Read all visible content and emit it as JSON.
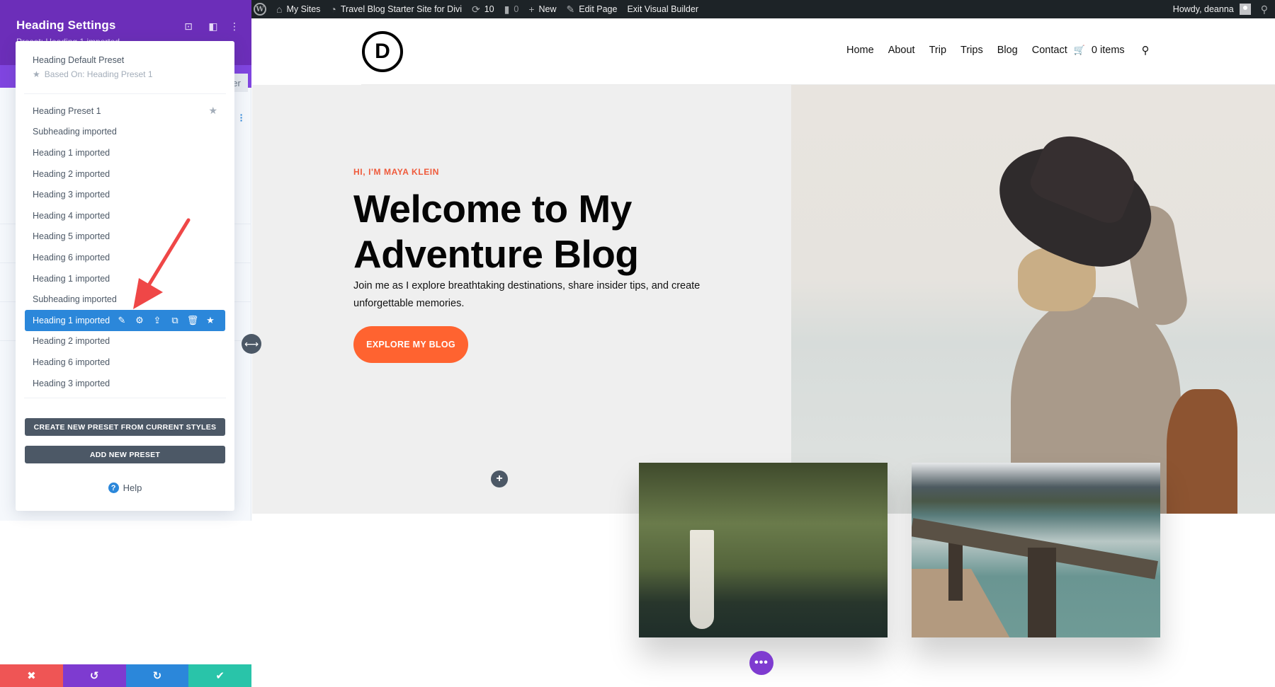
{
  "admin_bar": {
    "items": [
      {
        "icon": "wordpress-logo-icon",
        "label": ""
      },
      {
        "icon": "my-sites-icon",
        "label": "My Sites"
      },
      {
        "icon": "site-dashboard-icon",
        "label": "Travel Blog Starter Site for Divi"
      },
      {
        "icon": "updates-icon",
        "label": "10"
      },
      {
        "icon": "comments-icon",
        "label": "0"
      },
      {
        "icon": "plus-icon",
        "label": "New"
      },
      {
        "icon": "pencil-icon",
        "label": "Edit Page"
      },
      {
        "icon": "",
        "label": "Exit Visual Builder"
      }
    ],
    "greeting": "Howdy, deanna",
    "search_icon": "search-icon"
  },
  "settings_panel": {
    "title": "Heading Settings",
    "preset_label": "Preset: Heading 1 imported",
    "preset_caret": "▾",
    "tab_hint": "er",
    "header_icons": [
      "focus-icon",
      "layout-icon",
      "kebab-menu-icon"
    ]
  },
  "preset_dropdown": {
    "default_preset": {
      "name": "Heading Default Preset",
      "based_on": "Based On: Heading Preset 1"
    },
    "presets": [
      {
        "label": "Heading Preset 1",
        "starred": true,
        "active": false
      },
      {
        "label": "Subheading imported",
        "starred": false,
        "active": false
      },
      {
        "label": "Heading 1 imported",
        "starred": false,
        "active": false
      },
      {
        "label": "Heading 2 imported",
        "starred": false,
        "active": false
      },
      {
        "label": "Heading 3 imported",
        "starred": false,
        "active": false
      },
      {
        "label": "Heading 4 imported",
        "starred": false,
        "active": false
      },
      {
        "label": "Heading 5 imported",
        "starred": false,
        "active": false
      },
      {
        "label": "Heading 6 imported",
        "starred": false,
        "active": false
      },
      {
        "label": "Heading 1 imported",
        "starred": false,
        "active": false
      },
      {
        "label": "Subheading imported",
        "starred": false,
        "active": false
      },
      {
        "label": "Heading 1 imported",
        "starred": false,
        "active": true
      },
      {
        "label": "Heading 2 imported",
        "starred": false,
        "active": false
      },
      {
        "label": "Heading 6 imported",
        "starred": false,
        "active": false
      },
      {
        "label": "Heading 3 imported",
        "starred": false,
        "active": false
      }
    ],
    "active_tools": [
      "edit-icon",
      "settings-icon",
      "export-icon",
      "duplicate-icon",
      "delete-icon",
      "star-icon"
    ],
    "create_button": "CREATE NEW PRESET FROM CURRENT STYLES",
    "add_button": "ADD NEW PRESET",
    "help_label": "Help"
  },
  "bottom_bar": {
    "buttons": [
      {
        "name": "discard",
        "glyph": "✖"
      },
      {
        "name": "undo",
        "glyph": "↺"
      },
      {
        "name": "redo",
        "glyph": "↻"
      },
      {
        "name": "save",
        "glyph": "✔"
      }
    ]
  },
  "site": {
    "logo_letter": "D",
    "nav": [
      "Home",
      "About",
      "Trip",
      "Trips",
      "Blog",
      "Contact"
    ],
    "cart_label": "0 items",
    "hero": {
      "eyebrow": "HI, I'M MAYA KLEIN",
      "headline": "Welcome to My Adventure Blog",
      "subtext": "Join me as I explore breathtaking destinations, share insider tips, and create unforgettable memories.",
      "cta": "EXPLORE MY BLOG"
    },
    "images": [
      "woman-in-hat-photo",
      "waterfall-photo",
      "lake-dock-photo"
    ],
    "accent_color": "#ff6330",
    "eyebrow_color": "#ef5a3b"
  },
  "colors": {
    "panel_header": "#6c2eb9",
    "active_preset": "#2b87da",
    "button_dark": "#4c5866",
    "discard": "#ef5555",
    "undo": "#7e3bd0",
    "redo": "#2b87da",
    "save": "#29c4a9"
  }
}
